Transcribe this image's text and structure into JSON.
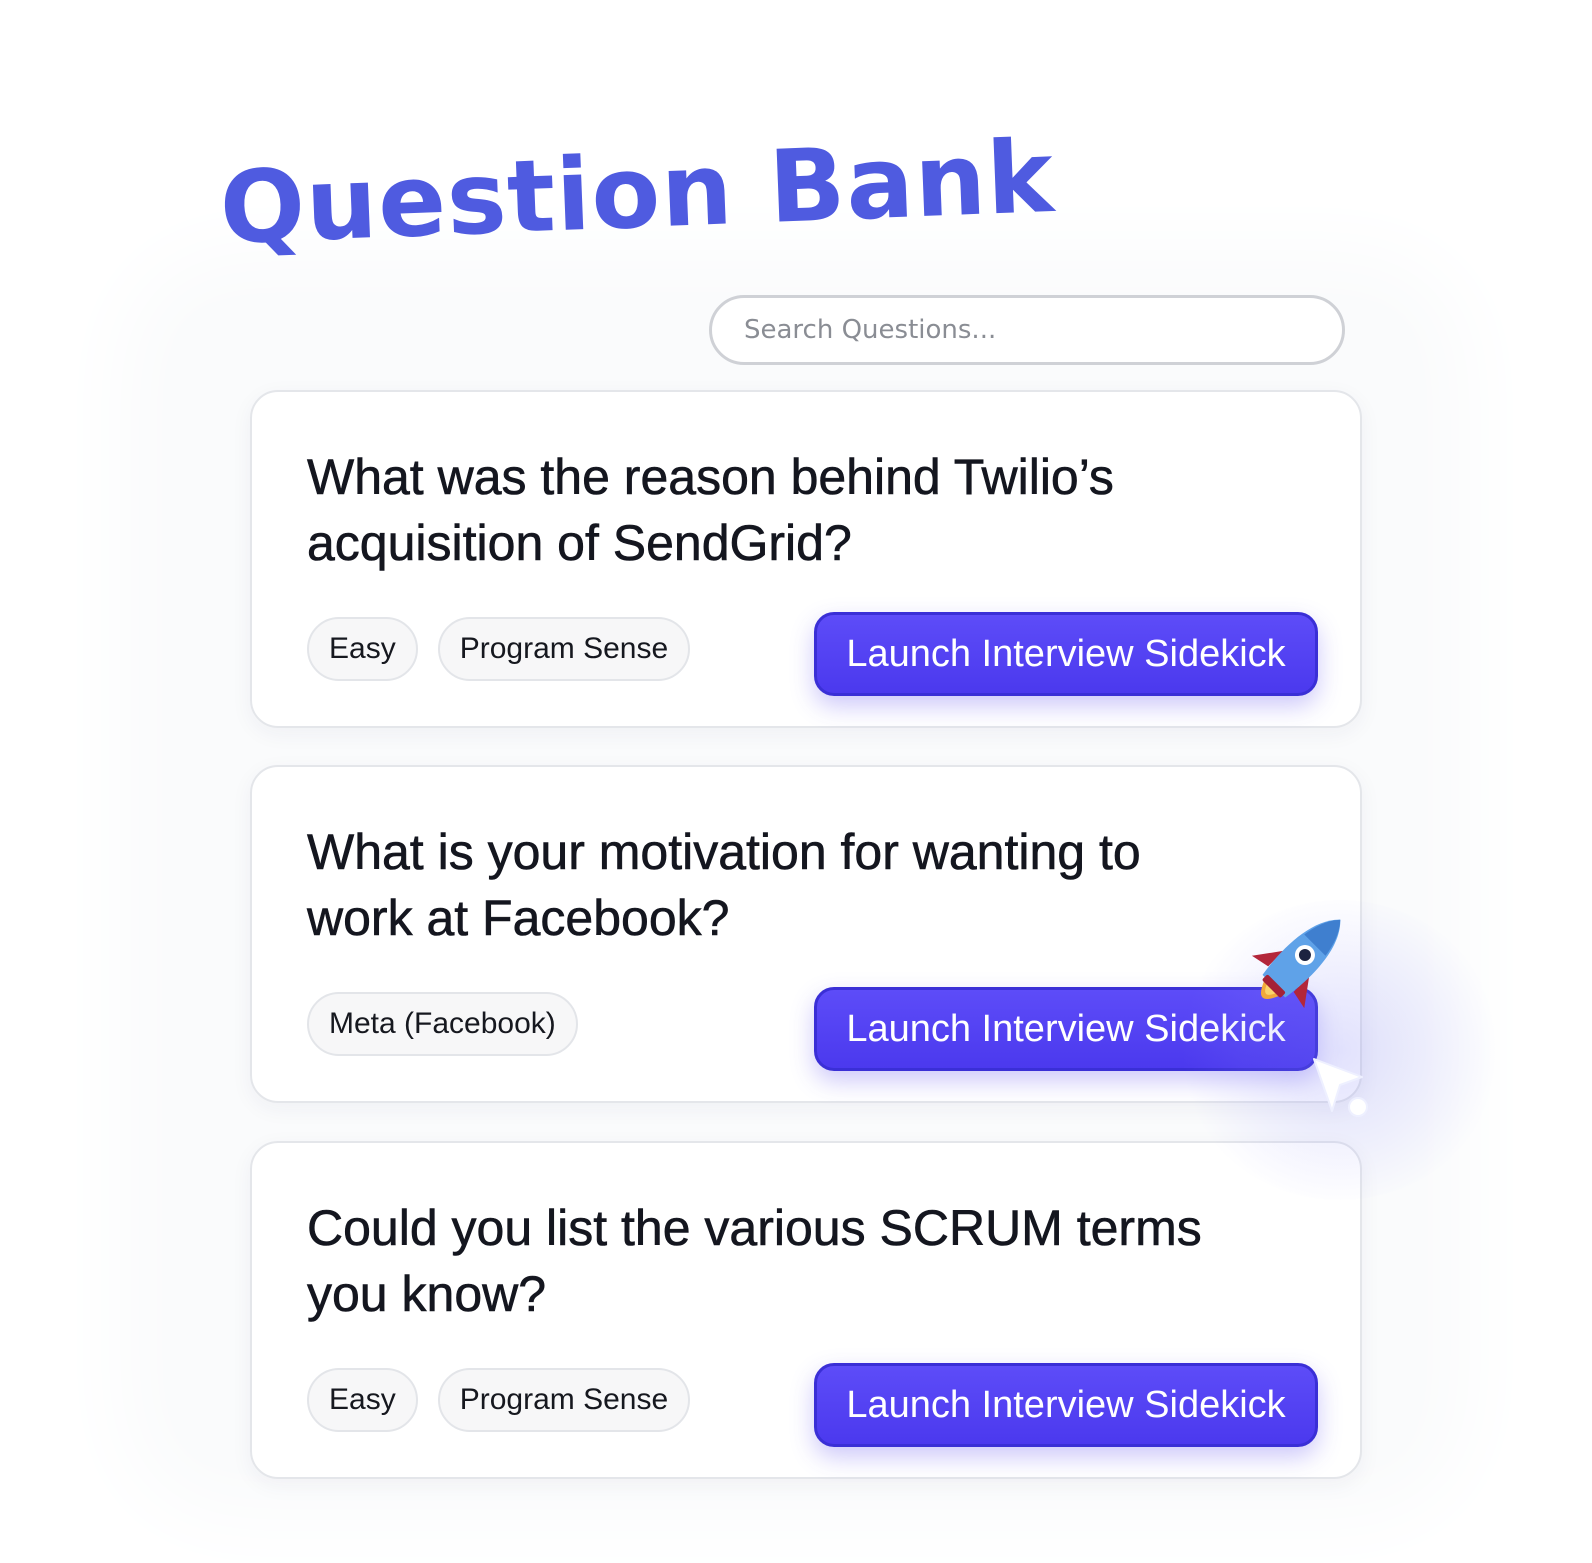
{
  "page": {
    "title": "Question Bank"
  },
  "search": {
    "placeholder": "Search Questions..."
  },
  "questions": [
    {
      "text": "What was the reason behind Twilio’s acquisition of SendGrid?",
      "tags": [
        "Easy",
        "Program Sense"
      ],
      "button_label": "Launch Interview Sidekick"
    },
    {
      "text": "What is your motivation for wanting to work at Facebook?",
      "tags": [
        "Meta (Facebook)"
      ],
      "button_label": "Launch Interview Sidekick"
    },
    {
      "text": "Could you list the various SCRUM terms you know?",
      "tags": [
        "Easy",
        "Program Sense"
      ],
      "button_label": "Launch Interview Sidekick"
    }
  ],
  "icons": {
    "rocket": "rocket-icon",
    "cursor": "pointer-cursor-icon"
  },
  "colors": {
    "title": "#4f5be0",
    "button": "#4b39ee",
    "text": "#14161f"
  }
}
